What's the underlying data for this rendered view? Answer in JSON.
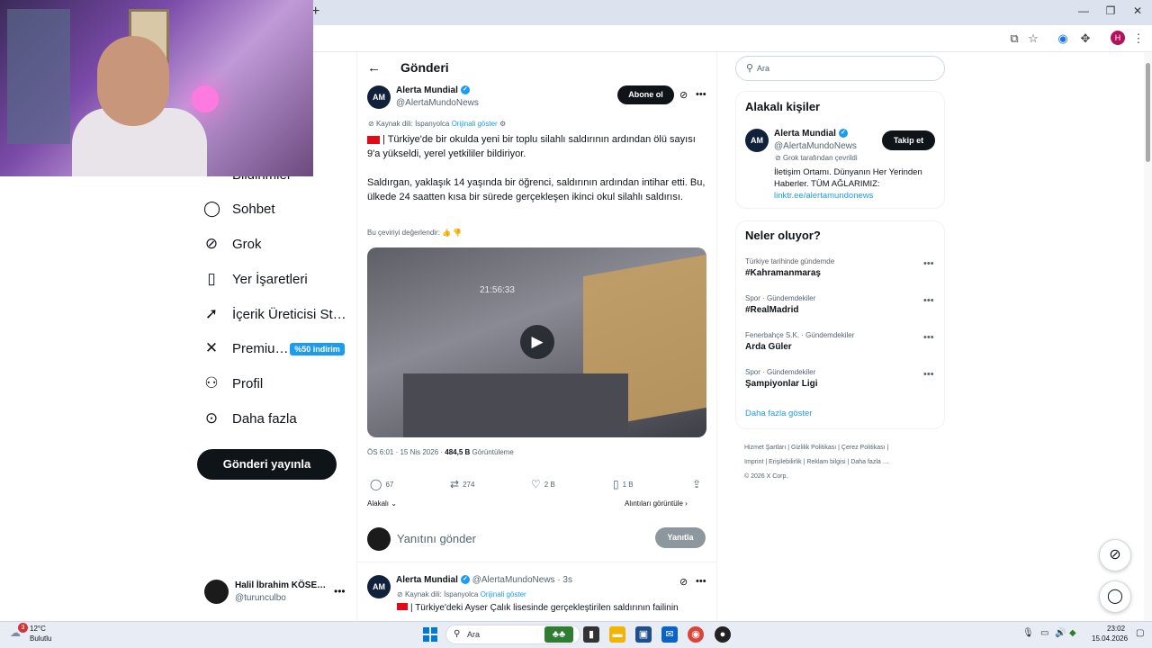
{
  "browser": {
    "newtab_symbol": "+",
    "window_minimize": "—",
    "window_restore": "❐",
    "window_close": "✕",
    "profile_initial": "H"
  },
  "nav": {
    "partial_label": "Bildirimler",
    "items": [
      {
        "label": "Sohbet",
        "icon": "chat-icon"
      },
      {
        "label": "Grok",
        "icon": "grok-icon"
      },
      {
        "label": "Yer İşaretleri",
        "icon": "bookmark-icon"
      },
      {
        "label": "İçerik Üreticisi St…",
        "icon": "rocket-icon"
      },
      {
        "label": "Premiu…",
        "icon": "x-logo-icon"
      },
      {
        "label": "Profil",
        "icon": "person-icon"
      },
      {
        "label": "Daha fazla",
        "icon": "more-circle-icon"
      }
    ],
    "premium_badge": "%50 indirim",
    "post_button": "Gönderi yayınla"
  },
  "account": {
    "name": "Halil İbrahim KÖSE…",
    "handle": "@turunculbo"
  },
  "post": {
    "page_title": "Gönderi",
    "author_name": "Alerta Mundial",
    "author_handle": "@AlertaMundoNews",
    "subscribe": "Abone ol",
    "source_lang": "Kaynak dili: İspanyolca",
    "show_original": "Orijinali göster",
    "text1": "| Türkiye'de bir okulda yeni bir toplu silahlı saldırının ardından ölü sayısı 9'a yükseldi, yerel yetkililer bildiriyor.",
    "text2": "Saldırgan, yaklaşık 14 yaşında bir öğrenci, saldırının ardından intihar etti. Bu, ülkede 24 saatten kısa bir sürede gerçekleşen ikinci okul silahlı saldırısı.",
    "rate_translation": "Bu çeviriyi değerlendir:",
    "video_timestamp": "21:56:33",
    "time": "ÖS 6:01 · 15 Nis 2026 ·",
    "views_count": "484,5 B",
    "views_label": "Görüntüleme",
    "replies": "67",
    "reposts": "274",
    "likes": "2 B",
    "bookmarks": "1 B",
    "related": "Alakalı",
    "quotes": "Alıntıları görüntüle",
    "reply_placeholder": "Yanıtını gönder",
    "reply_button": "Yanıtla"
  },
  "reply_tweet": {
    "author_name": "Alerta Mundial",
    "meta": "@AlertaMundoNews · 3s",
    "source_lang": "Kaynak dili: İspanyolca",
    "show_original": "Orijinali göster",
    "text": "| Türkiye'deki Ayser Çalık lisesinde gerçekleştirilen saldırının failinin"
  },
  "right": {
    "search_placeholder": "Ara",
    "people_title": "Alakalı kişiler",
    "person_name": "Alerta Mundial",
    "person_handle": "@AlertaMundoNews",
    "follow": "Takip et",
    "grok_translated": "Grok tarafından çevrildi",
    "bio": "İletişim Ortamı. Dünyanın Her Yerinden Haberler. TÜM AĞLARIMIZ:",
    "bio_link": "linktr.ee/alertamundonews",
    "trends_title": "Neler oluyor?",
    "trends": [
      {
        "context": "Türkiye tarihinde gündemde",
        "name": "#Kahramanmaraş"
      },
      {
        "context": "Spor · Gündemdekiler",
        "name": "#RealMadrid"
      },
      {
        "context": "Fenerbahçe S.K. · Gündemdekiler",
        "name": "Arda Güler"
      },
      {
        "context": "Spor · Gündemdekiler",
        "name": "Şampiyonlar Ligi"
      }
    ],
    "show_more": "Daha fazla göster",
    "footer": [
      "Hizmet Şartları",
      "Gizlilik Politikası",
      "Çerez Politikası",
      "Imprint",
      "Erişilebilirlik",
      "Reklam bilgisi",
      "Daha fazla …",
      "© 2026 X Corp."
    ]
  },
  "taskbar": {
    "weather_temp": "12°C",
    "weather_desc": "Bulutlu",
    "weather_badge": "3",
    "search_placeholder": "Ara",
    "time": "23:02",
    "date": "15.04.2026"
  }
}
